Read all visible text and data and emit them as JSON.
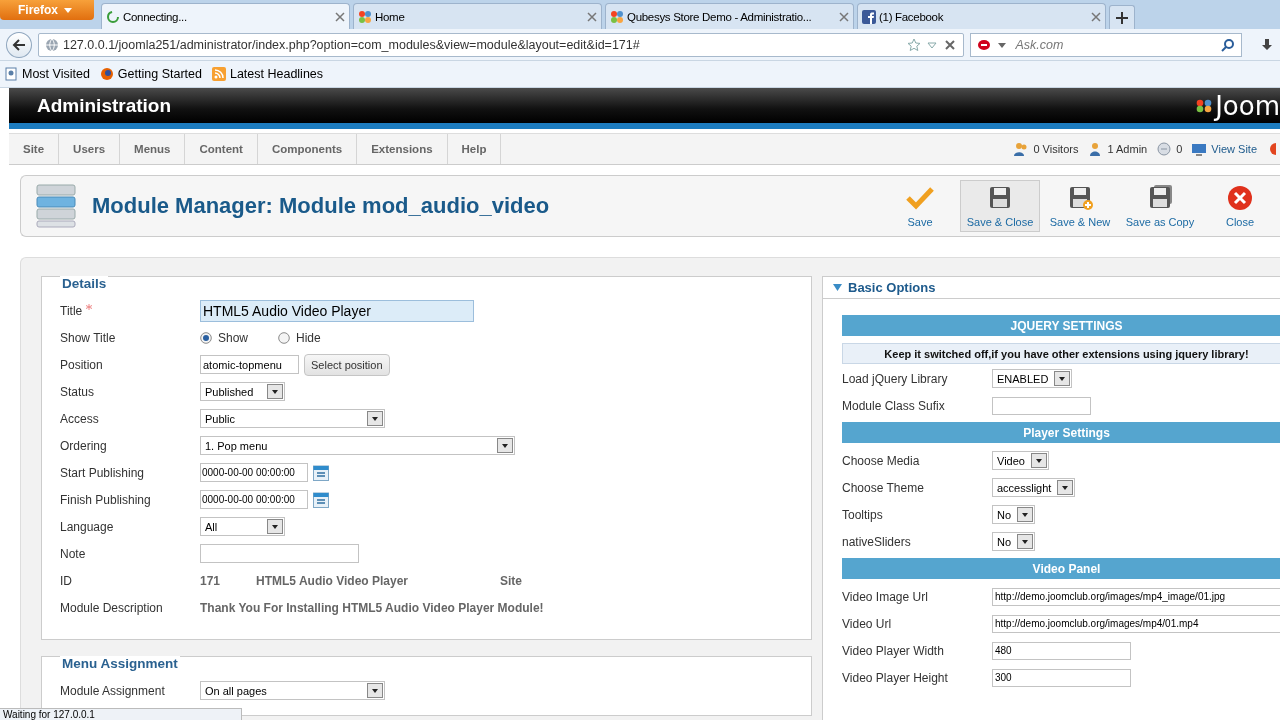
{
  "browser": {
    "menu_button": "Firefox",
    "tabs": [
      {
        "label": "Connecting...",
        "selected": true,
        "loading": true
      },
      {
        "label": "Home",
        "selected": false,
        "loading": false
      },
      {
        "label": "Qubesys Store Demo - Administratio...",
        "selected": false,
        "loading": false
      },
      {
        "label": "(1) Facebook",
        "selected": false,
        "loading": false
      }
    ],
    "url": "127.0.0.1/joomla251/administrator/index.php?option=com_modules&view=module&layout=edit&id=171#",
    "search": {
      "placeholder": "Ask.com"
    },
    "bookmarks": [
      "Most Visited",
      "Getting Started",
      "Latest Headlines"
    ]
  },
  "header": {
    "title": "Administration",
    "logo_text": "Joom"
  },
  "menu": [
    "Site",
    "Users",
    "Menus",
    "Content",
    "Components",
    "Extensions",
    "Help"
  ],
  "status_items": [
    {
      "label": "0 Visitors",
      "kind": "users"
    },
    {
      "label": "1 Admin",
      "kind": "admin"
    },
    {
      "label": "0",
      "kind": "messages"
    },
    {
      "label": "View Site",
      "kind": "link"
    }
  ],
  "toolbar": {
    "title": "Module Manager: Module mod_audio_video",
    "buttons": [
      {
        "label": "Save",
        "kind": "apply",
        "highlighted": false
      },
      {
        "label": "Save & Close",
        "kind": "save",
        "highlighted": true
      },
      {
        "label": "Save & New",
        "kind": "new",
        "highlighted": false
      },
      {
        "label": "Save as Copy",
        "kind": "copy",
        "highlighted": false
      },
      {
        "label": "Close",
        "kind": "close",
        "highlighted": false
      }
    ]
  },
  "details": {
    "legend": "Details",
    "fields": [
      {
        "kind": "text",
        "label": "Title",
        "required": true,
        "value": "HTML5 Audio Video Player",
        "focused": true
      },
      {
        "kind": "radio",
        "label": "Show Title",
        "options": [
          {
            "label": "Show",
            "selected": true
          },
          {
            "label": "Hide",
            "selected": false
          }
        ]
      },
      {
        "kind": "position",
        "label": "Position",
        "value": "atomic-topmenu",
        "button": "Select position"
      },
      {
        "kind": "select",
        "label": "Status",
        "value": "Published"
      },
      {
        "kind": "select",
        "label": "Access",
        "value": "Public"
      },
      {
        "kind": "select",
        "label": "Ordering",
        "value": "1. Pop menu"
      },
      {
        "kind": "date",
        "label": "Start Publishing",
        "value": "0000-00-00 00:00:00"
      },
      {
        "kind": "date",
        "label": "Finish Publishing",
        "value": "0000-00-00 00:00:00"
      },
      {
        "kind": "select",
        "label": "Language",
        "value": "All"
      },
      {
        "kind": "text",
        "label": "Note",
        "required": false,
        "focused": false
      },
      {
        "kind": "info",
        "label": "ID",
        "values": [
          "171",
          "HTML5 Audio Video Player",
          "Site"
        ]
      },
      {
        "kind": "description",
        "label": "Module Description",
        "value": "Thank You For Installing HTML5 Audio Video Player Module!"
      }
    ]
  },
  "menu_assignment": {
    "legend": "Menu Assignment",
    "fields": [
      {
        "kind": "select",
        "label": "Module Assignment",
        "value": "On all pages"
      }
    ]
  },
  "basic_options": {
    "title": "Basic Options",
    "expanded": true,
    "items": [
      {
        "kind": "header",
        "label": "JQUERY SETTINGS"
      },
      {
        "kind": "note",
        "label": "Keep it switched off,if you have other extensions using jquery library!"
      },
      {
        "kind": "select",
        "label": "Load jQuery Library",
        "value": "ENABLED"
      },
      {
        "kind": "text",
        "label": "Module Class Sufix"
      },
      {
        "kind": "header",
        "label": "Player Settings"
      },
      {
        "kind": "select",
        "label": "Choose Media",
        "value": "Video"
      },
      {
        "kind": "select",
        "label": "Choose Theme",
        "value": "accesslight"
      },
      {
        "kind": "select",
        "label": "Tooltips",
        "value": "No"
      },
      {
        "kind": "select",
        "label": "nativeSliders",
        "value": "No"
      },
      {
        "kind": "header",
        "label": "Video Panel"
      },
      {
        "kind": "text",
        "label": "Video Image Url",
        "value": "http://demo.joomclub.org/images/mp4_image/01.jpg"
      },
      {
        "kind": "text",
        "label": "Video Url",
        "value": "http://demo.joomclub.org/images/mp4/01.mp4"
      },
      {
        "kind": "text",
        "label": "Video Player Width",
        "value": "480"
      },
      {
        "kind": "text",
        "label": "Video Player Height",
        "value": "300"
      }
    ]
  },
  "status_bar": "Waiting for 127.0.0.1"
}
